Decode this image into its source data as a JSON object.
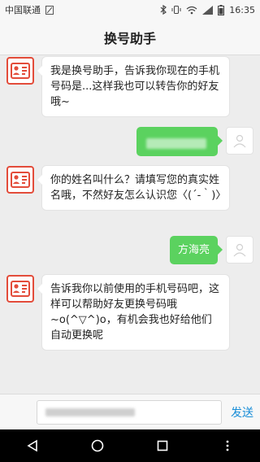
{
  "status_bar": {
    "carrier": "中国联通",
    "time": "16:35"
  },
  "header": {
    "title": "换号助手"
  },
  "messages": [
    {
      "side": "left",
      "text": "我是换号助手，告诉我你现在的手机号码是...这样我也可以转告你的好友哦~"
    },
    {
      "side": "right",
      "blurred": true
    },
    {
      "side": "left",
      "text": "你的姓名叫什么？请填写您的真实姓名哦，不然好友怎么认识您〈(´-｀)〉"
    },
    {
      "side": "right",
      "text": "方海亮"
    },
    {
      "side": "left",
      "text": "告诉我你以前使用的手机号码吧，这样可以帮助好友更换号码哦~o(^▽^)o，有机会我也好给他们自动更换呢"
    }
  ],
  "input": {
    "send_label": "发送"
  },
  "colors": {
    "bot_accent": "#e34c3a",
    "user_bubble": "#5bd25f",
    "send_text": "#1a8ed8"
  },
  "icons": [
    "sim-icon",
    "bluetooth-icon",
    "vibrate-icon",
    "wifi-icon",
    "signal-icon",
    "battery-icon",
    "id-card-icon",
    "user-placeholder-icon",
    "back-icon",
    "home-icon",
    "recents-icon",
    "menu-icon"
  ]
}
